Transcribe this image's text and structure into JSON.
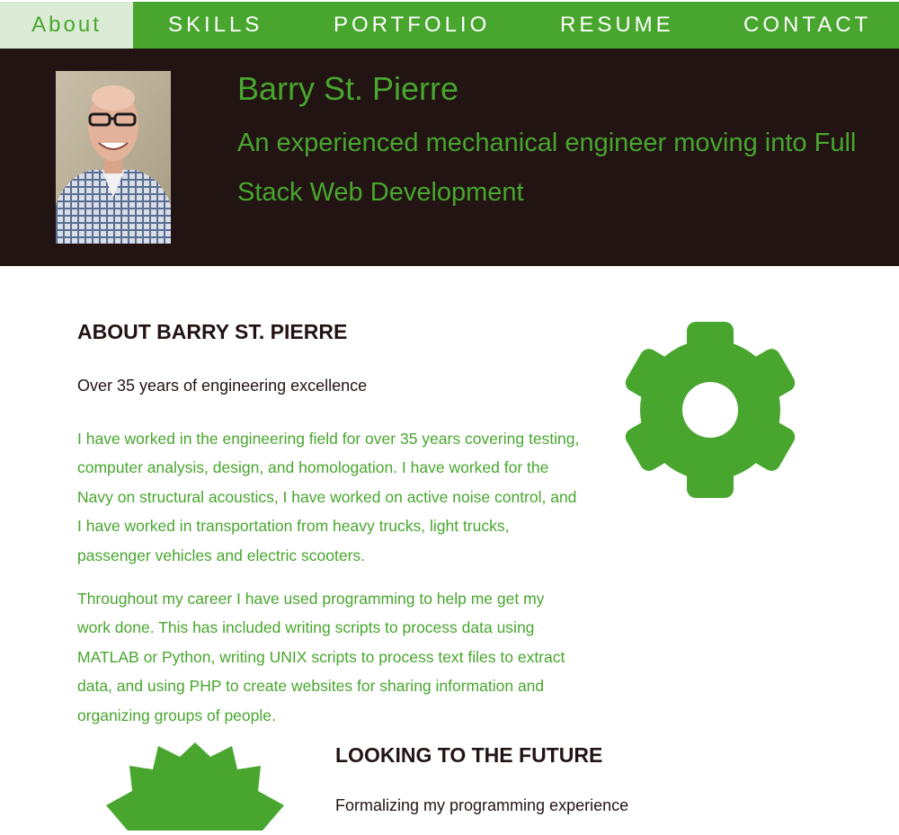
{
  "nav": {
    "items": [
      {
        "label": "About",
        "active": true
      },
      {
        "label": "SKILLS"
      },
      {
        "label": "PORTFOLIO"
      },
      {
        "label": "RESUME"
      },
      {
        "label": "CONTACT"
      }
    ]
  },
  "header": {
    "name": "Barry St. Pierre",
    "tagline": "An experienced mechanical engineer moving into Full Stack Web Development"
  },
  "about": {
    "title": "ABOUT BARRY ST. PIERRE",
    "subtitle": "Over 35 years of engineering excellence",
    "paragraphs": [
      "I have worked in the engineering field for over 35 years covering testing, computer analysis, design, and homologation. I have worked for the Navy on structural acoustics, I have worked on active noise control, and I have worked in transportation from heavy trucks, light trucks, passenger vehicles and electric scooters.",
      "Throughout my career I have used programming to help me get my work done. This has included writing scripts to process data using MATLAB or Python, writing UNIX scripts to process text files to extract data, and using PHP to create websites for sharing information and organizing groups of people."
    ],
    "icon": "gear-icon"
  },
  "future": {
    "title": "LOOKING TO THE FUTURE",
    "subtitle": "Formalizing my programming experience",
    "icon": "badge-star-icon"
  },
  "colors": {
    "accent": "#48a62e",
    "dark": "#231414",
    "active_tab_bg": "#dcebd6",
    "white": "#ffffff"
  }
}
